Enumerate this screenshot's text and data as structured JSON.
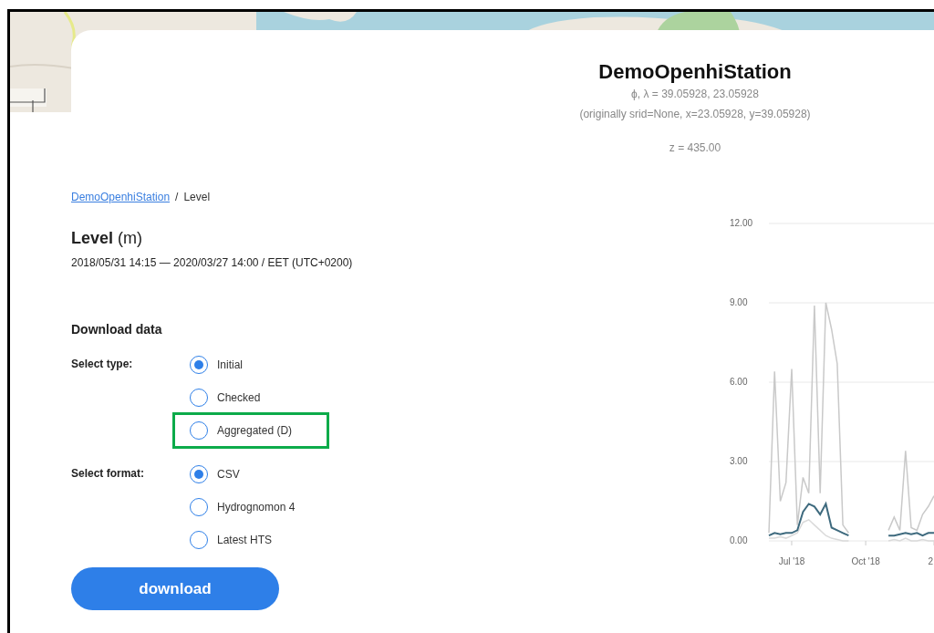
{
  "header": {
    "title": "DemoOpenhiStation",
    "coordinates": "ϕ, λ = 39.05928, 23.05928",
    "original_coordinates": "(originally srid=None, x=23.05928, y=39.05928)",
    "altitude": "z = 435.00"
  },
  "breadcrumb": {
    "link": "DemoOpenhiStation",
    "separator": "/",
    "current": "Level"
  },
  "variable": {
    "title": "**Level** (m)",
    "period": "2018/05/31 14:15 — 2020/03/27 14:00 / EET (UTC+0200)"
  },
  "download": {
    "heading": "Download data",
    "type_label": "Select type:",
    "type_options": [
      {
        "label": "Initial",
        "selected": true,
        "highlighted": false
      },
      {
        "label": "Checked",
        "selected": false,
        "highlighted": false
      },
      {
        "label": "Aggregated (D)",
        "selected": false,
        "highlighted": true
      }
    ],
    "format_label": "Select format:",
    "format_options": [
      {
        "label": "CSV",
        "selected": true
      },
      {
        "label": "Hydrognomon 4",
        "selected": false
      },
      {
        "label": "Latest HTS",
        "selected": false
      }
    ],
    "button": "download"
  },
  "chart_data": {
    "type": "line",
    "categories": [
      null,
      null,
      null,
      null,
      "Jul '18",
      null,
      null,
      null,
      null,
      null,
      null,
      null,
      null,
      null,
      null,
      null,
      null,
      "Oct '18",
      null,
      null,
      null,
      null,
      null,
      null,
      null,
      null,
      null,
      null,
      null,
      "2"
    ],
    "ylim": [
      0,
      12
    ],
    "grid": true,
    "yticks": [
      {
        "value": 0,
        "label": "0.00"
      },
      {
        "value": 3,
        "label": "3.00"
      },
      {
        "value": 6,
        "label": "6.00"
      },
      {
        "value": 9,
        "label": "9.00"
      },
      {
        "value": 12,
        "label": "12.00"
      }
    ],
    "series": [
      {
        "color": "#c9c9c9",
        "values": [
          0.3,
          6.4,
          1.5,
          2.2,
          6.5,
          0.6,
          2.4,
          1.8,
          8.9,
          1.8,
          9.0,
          8.0,
          6.7,
          0.6,
          0.3,
          null,
          null,
          null,
          null,
          null,
          null,
          0.4,
          0.9,
          0.4,
          3.4,
          0.5,
          0.4,
          1.0,
          1.3,
          1.7
        ]
      },
      {
        "color": "#dadada",
        "values": [
          0.1,
          0.1,
          0.15,
          0.1,
          0.2,
          0.3,
          0.7,
          0.8,
          0.6,
          0.4,
          0.2,
          0.1,
          0.05,
          0.0,
          0.0,
          null,
          null,
          null,
          null,
          null,
          null,
          0.0,
          0.05,
          0.0,
          0.1,
          0.0,
          0.0,
          0.05,
          0.0,
          0.0
        ]
      },
      {
        "color": "#3e6a7e",
        "values": [
          0.2,
          0.3,
          0.25,
          0.3,
          0.3,
          0.4,
          1.1,
          1.4,
          1.3,
          1.0,
          1.4,
          0.5,
          0.4,
          0.3,
          0.2,
          null,
          null,
          null,
          null,
          null,
          null,
          0.2,
          0.2,
          0.25,
          0.3,
          0.25,
          0.3,
          0.2,
          0.3,
          0.3
        ]
      }
    ]
  }
}
